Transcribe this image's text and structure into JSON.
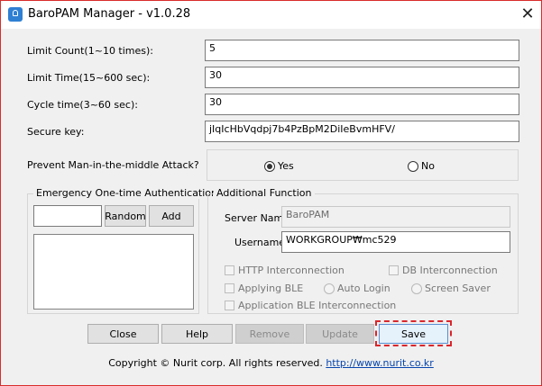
{
  "window": {
    "title": "BaroPAM Manager - v1.0.28",
    "close_glyph": "✕"
  },
  "fields": {
    "limit_count": {
      "label": "Limit Count(1~10 times):",
      "value": "5"
    },
    "limit_time": {
      "label": "Limit Time(15~600 sec):",
      "value": "30"
    },
    "cycle_time": {
      "label": "Cycle time(3~60 sec):",
      "value": "30"
    },
    "secure_key": {
      "label": "Secure key:",
      "value": "jIqIcHbVqdpj7b4PzBpM2DiIeBvmHFV/"
    }
  },
  "mitm": {
    "label": "Prevent Man-in-the-middle Attack?",
    "options": [
      {
        "label": "Yes",
        "checked": true
      },
      {
        "label": "No",
        "checked": false
      }
    ]
  },
  "emergency": {
    "title": "Emergency One-time Authentication Key",
    "input_value": "",
    "random_label": "Random",
    "add_label": "Add"
  },
  "additional": {
    "title": "Additional Function",
    "server_name_label": "Server Name",
    "server_name_value": "BaroPAM",
    "username_label": "Username",
    "username_value": "WORKGROUP₩mc529",
    "options": {
      "http": "HTTP Interconnection",
      "db": "DB Interconnection",
      "ble": "Applying BLE",
      "auto_login": "Auto Login",
      "screen_saver": "Screen Saver",
      "app_ble": "Application BLE Interconnection"
    }
  },
  "buttons": {
    "close": "Close",
    "help": "Help",
    "remove": "Remove",
    "update": "Update",
    "save": "Save"
  },
  "footer": {
    "copyright": "Copyright © Nurit corp. All rights reserved.",
    "link": "http://www.nurit.co.kr"
  },
  "colors": {
    "accent_border": "#d9262c",
    "link": "#0645ad"
  }
}
